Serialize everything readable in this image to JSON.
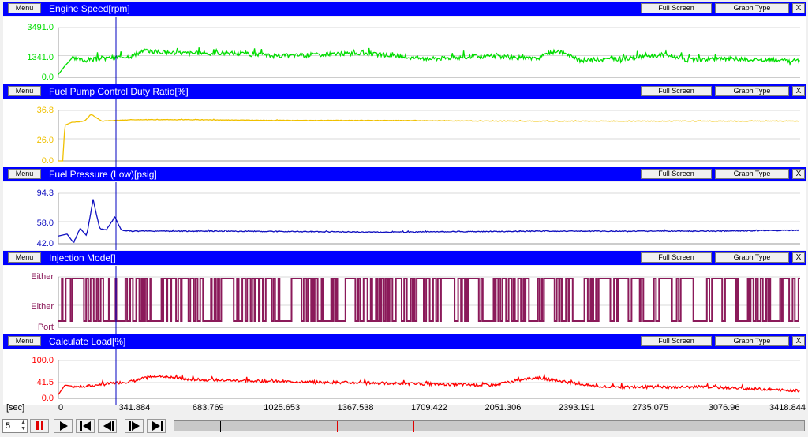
{
  "buttons": {
    "menu": "Menu",
    "full_screen": "Full Screen",
    "graph_type": "Graph Type",
    "close": "X"
  },
  "panels": [
    {
      "title": "Engine Speed[rpm]",
      "color": "#00dd00",
      "y_labels": [
        "3491.0",
        "1341.0",
        "0.0"
      ],
      "ymin": 0,
      "ymax": 3491
    },
    {
      "title": "Fuel Pump Control Duty Ratio[%]",
      "color": "#f0c000",
      "y_labels": [
        "36.8",
        "26.0",
        "0.0"
      ],
      "ymin": 0,
      "ymax": 36.8
    },
    {
      "title": "Fuel Pressure (Low)[psig]",
      "color": "#1010c0",
      "y_labels": [
        "94.3",
        "58.0",
        "42.0"
      ],
      "ymin": 42,
      "ymax": 94.3
    },
    {
      "title": "Injection Mode[]",
      "color": "#8b1a5a",
      "y_labels": [
        "Either",
        "Either",
        "Port"
      ],
      "ymin": 0,
      "ymax": 1
    },
    {
      "title": "Calculate Load[%]",
      "color": "#ff0000",
      "y_labels": [
        "100.0",
        "41.5",
        "0.0"
      ],
      "ymin": 0,
      "ymax": 100
    }
  ],
  "x_axis": {
    "unit": "[sec]",
    "ticks": [
      "0",
      "341.884",
      "683.769",
      "1025.653",
      "1367.538",
      "1709.422",
      "2051.306",
      "2393.191",
      "2735.075",
      "3076.96",
      "3418.844"
    ]
  },
  "controls": {
    "speed_value": "5",
    "icons": [
      "pause-icon",
      "play-icon",
      "skip-start-icon",
      "step-back-icon",
      "step-forward-icon",
      "skip-end-icon"
    ]
  },
  "cursor_color": "#0000c0",
  "chart_data": [
    {
      "type": "line",
      "ylabel": "Engine Speed[rpm]",
      "xlim": [
        0,
        3418.844
      ],
      "ylim": [
        0,
        3491
      ],
      "series": [
        {
          "name": "Engine Speed[rpm]",
          "x": [
            0,
            30,
            60,
            120,
            250,
            341,
            400,
            450,
            600,
            800,
            1000,
            1200,
            1400,
            1550,
            1700,
            1850,
            2000,
            2200,
            2300,
            2400,
            2600,
            2800,
            2900,
            3050,
            3200,
            3418
          ],
          "values": [
            200,
            800,
            1300,
            1200,
            1400,
            1500,
            1900,
            1800,
            1700,
            1700,
            1500,
            1600,
            1700,
            1500,
            1300,
            1400,
            1500,
            1300,
            1900,
            1200,
            1300,
            1600,
            1200,
            1300,
            1200,
            1200
          ]
        }
      ]
    },
    {
      "type": "line",
      "ylabel": "Fuel Pump Control Duty Ratio[%]",
      "xlim": [
        0,
        3418.844
      ],
      "ylim": [
        0,
        36.8
      ],
      "series": [
        {
          "name": "Fuel Pump Control Duty Ratio[%]",
          "x": [
            0,
            20,
            30,
            60,
            120,
            150,
            200,
            341,
            600,
            1000,
            1500,
            2000,
            2500,
            3000,
            3418
          ],
          "values": [
            0,
            0,
            26,
            28,
            29,
            34,
            29,
            30,
            30,
            29.5,
            29.5,
            29,
            29,
            29,
            29
          ]
        }
      ]
    },
    {
      "type": "line",
      "ylabel": "Fuel Pressure (Low)[psig]",
      "xlim": [
        0,
        3418.844
      ],
      "ylim": [
        42,
        94.3
      ],
      "series": [
        {
          "name": "Fuel Pressure (Low)[psig]",
          "x": [
            0,
            40,
            70,
            100,
            130,
            160,
            190,
            220,
            260,
            290,
            341,
            800,
            1500,
            2200,
            3000,
            3418
          ],
          "values": [
            50,
            52,
            43,
            58,
            50,
            88,
            58,
            56,
            70,
            56,
            55,
            55,
            54,
            55,
            55,
            56
          ]
        }
      ]
    },
    {
      "type": "line",
      "ylabel": "Injection Mode[]",
      "xlim": [
        0,
        3418.844
      ],
      "ylim": [
        0,
        1
      ],
      "y_categories": [
        "Port",
        "Either",
        "Either"
      ],
      "series": [
        {
          "name": "Injection Mode[]",
          "x": [
            0,
            3418
          ],
          "values": [
            0,
            0
          ]
        }
      ]
    },
    {
      "type": "line",
      "ylabel": "Calculate Load[%]",
      "xlim": [
        0,
        3418.844
      ],
      "ylim": [
        0,
        100
      ],
      "series": [
        {
          "name": "Calculate Load[%]",
          "x": [
            0,
            30,
            100,
            250,
            341,
            450,
            600,
            1000,
            1500,
            2000,
            2200,
            2500,
            3000,
            3418
          ],
          "values": [
            10,
            35,
            30,
            40,
            45,
            60,
            50,
            45,
            40,
            35,
            55,
            30,
            30,
            20
          ]
        }
      ]
    }
  ]
}
